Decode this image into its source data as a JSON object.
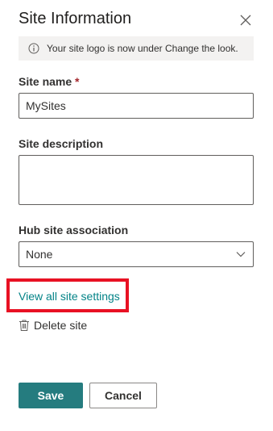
{
  "panel": {
    "title": "Site Information",
    "close_icon": "close-icon"
  },
  "info_bar": {
    "icon": "info-icon",
    "message": "Your site logo is now under Change the look."
  },
  "site_name": {
    "label": "Site name",
    "required_marker": "*",
    "value": "MySites"
  },
  "site_description": {
    "label": "Site description",
    "value": ""
  },
  "hub_site": {
    "label": "Hub site association",
    "selected": "None",
    "chevron_icon": "chevron-down-icon"
  },
  "links": {
    "view_all_settings": "View all site settings",
    "delete_site": "Delete site",
    "delete_icon": "trash-icon"
  },
  "buttons": {
    "save": "Save",
    "cancel": "Cancel"
  },
  "colors": {
    "accent": "#257c7f",
    "link": "#038387",
    "highlight": "#e81123",
    "info_bg": "#f3f2f1"
  }
}
